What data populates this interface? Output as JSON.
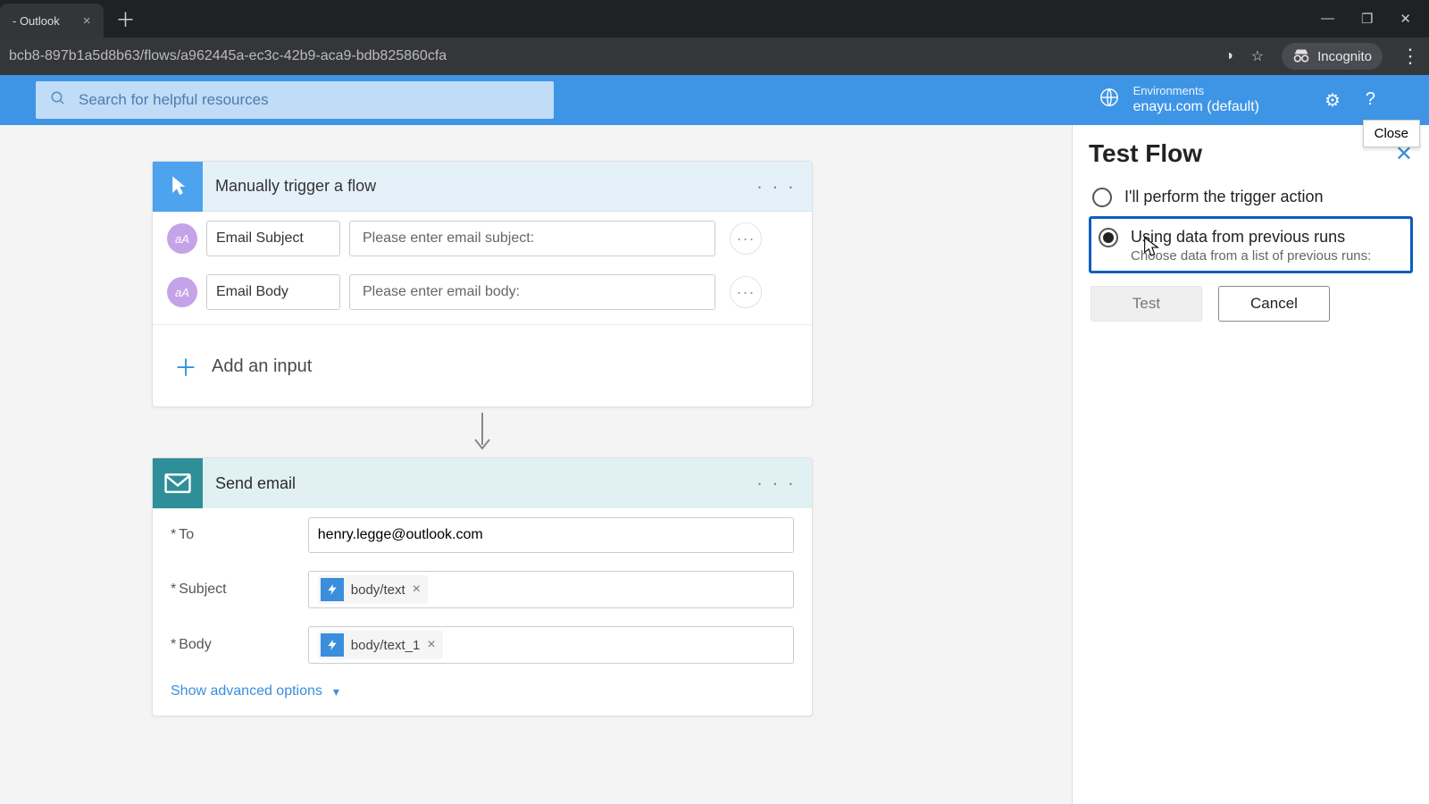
{
  "browser": {
    "tab_title": "- Outlook",
    "new_tab_glyph": "＋",
    "url": "bcb8-897b1a5d8b63/flows/a962445a-ec3c-42b9-aca9-bdb825860cfa",
    "incognito_label": "Incognito",
    "win": {
      "min": "—",
      "max": "❐",
      "close": "✕"
    },
    "addr_icons": {
      "eye": "◑",
      "star": "☆",
      "kebab": "⋮"
    }
  },
  "header": {
    "search_placeholder": "Search for helpful resources",
    "env_label": "Environments",
    "env_name": "enayu.com (default)",
    "close_tooltip": "Close",
    "settings_glyph": "⚙",
    "help_glyph": "?"
  },
  "trigger_card": {
    "title": "Manually trigger a flow",
    "menu_glyph": "· · ·",
    "params": [
      {
        "name": "Email Subject",
        "placeholder": "Please enter email subject:"
      },
      {
        "name": "Email Body",
        "placeholder": "Please enter email body:"
      }
    ],
    "badge_text": "aA",
    "add_input_label": "Add an input",
    "add_plus_glyph": "＋"
  },
  "email_card": {
    "title": "Send email",
    "menu_glyph": "· · ·",
    "labels": {
      "to": "To",
      "subject": "Subject",
      "body": "Body",
      "ast": "*"
    },
    "to_value": "henry.legge@outlook.com",
    "subject_token": "body/text",
    "body_token": "body/text_1",
    "show_advanced": "Show advanced options",
    "token_x": "×"
  },
  "panel": {
    "title": "Test Flow",
    "close_glyph": "✕",
    "option1": "I'll perform the trigger action",
    "option2": "Using data from previous runs",
    "option2_sub": "Choose data from a list of previous runs:",
    "btn_test": "Test",
    "btn_cancel": "Cancel"
  }
}
